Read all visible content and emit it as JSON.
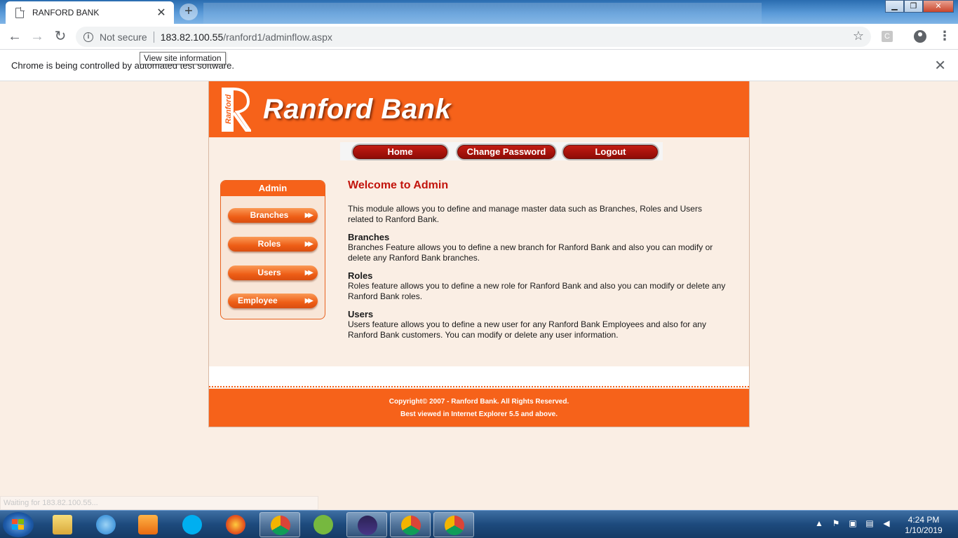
{
  "browser": {
    "tab_title": "RANFORD BANK",
    "tab_close": "✕",
    "new_tab": "+",
    "not_secure": "Not secure",
    "url_host": "183.82.100.55",
    "url_path": "/ranford1/adminflow.aspx",
    "tooltip": "View site information",
    "infobar_text": "Chrome is being controlled by automated test software.",
    "infobar_close": "✕",
    "extension_badge": "C",
    "status_text": "Waiting for 183.82.100.55..."
  },
  "header": {
    "brand": "Ranford Bank",
    "logo_text": "Ranford"
  },
  "topnav": {
    "home": "Home",
    "change_password": "Change Password",
    "logout": "Logout"
  },
  "sidebar": {
    "title": "Admin",
    "items": [
      {
        "label": "Branches"
      },
      {
        "label": "Roles"
      },
      {
        "label": "Users"
      },
      {
        "label": "Employee"
      }
    ]
  },
  "content": {
    "title": "Welcome to Admin",
    "intro": "This module allows you to define and manage master data such as Branches, Roles and Users related to Ranford Bank.",
    "sections": [
      {
        "heading": "Branches",
        "text": "Branches Feature allows you to define a new branch for Ranford Bank and also you can modify or delete any Ranford Bank branches."
      },
      {
        "heading": "Roles",
        "text": "Roles feature allows you to define a new role for Ranford Bank and also you can modify or delete any Ranford Bank roles."
      },
      {
        "heading": "Users",
        "text": "Users feature allows you to define a new user for any Ranford Bank Employees and also for any Ranford Bank customers. You can modify or delete any user information."
      }
    ]
  },
  "footer": {
    "copyright": "Copyright© 2007 - Ranford Bank. All Rights Reserved.",
    "best_viewed": "Best viewed in Internet Explorer 5.5 and above."
  },
  "taskbar": {
    "time": "4:24 PM",
    "date": "1/10/2019"
  },
  "colors": {
    "brand_orange": "#f6621a",
    "nav_red": "#c21b12",
    "title_red": "#c2140c",
    "page_bg": "#faeee4"
  }
}
